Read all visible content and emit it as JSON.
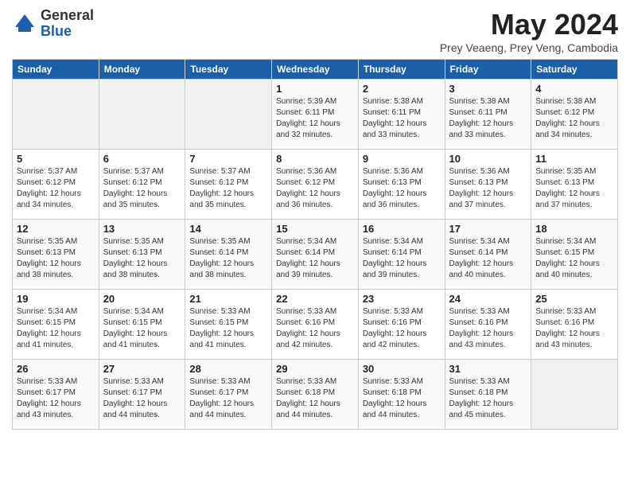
{
  "logo": {
    "general": "General",
    "blue": "Blue"
  },
  "title": "May 2024",
  "location": "Prey Veaeng, Prey Veng, Cambodia",
  "days_header": [
    "Sunday",
    "Monday",
    "Tuesday",
    "Wednesday",
    "Thursday",
    "Friday",
    "Saturday"
  ],
  "weeks": [
    [
      {
        "day": "",
        "info": ""
      },
      {
        "day": "",
        "info": ""
      },
      {
        "day": "",
        "info": ""
      },
      {
        "day": "1",
        "info": "Sunrise: 5:39 AM\nSunset: 6:11 PM\nDaylight: 12 hours\nand 32 minutes."
      },
      {
        "day": "2",
        "info": "Sunrise: 5:38 AM\nSunset: 6:11 PM\nDaylight: 12 hours\nand 33 minutes."
      },
      {
        "day": "3",
        "info": "Sunrise: 5:38 AM\nSunset: 6:11 PM\nDaylight: 12 hours\nand 33 minutes."
      },
      {
        "day": "4",
        "info": "Sunrise: 5:38 AM\nSunset: 6:12 PM\nDaylight: 12 hours\nand 34 minutes."
      }
    ],
    [
      {
        "day": "5",
        "info": "Sunrise: 5:37 AM\nSunset: 6:12 PM\nDaylight: 12 hours\nand 34 minutes."
      },
      {
        "day": "6",
        "info": "Sunrise: 5:37 AM\nSunset: 6:12 PM\nDaylight: 12 hours\nand 35 minutes."
      },
      {
        "day": "7",
        "info": "Sunrise: 5:37 AM\nSunset: 6:12 PM\nDaylight: 12 hours\nand 35 minutes."
      },
      {
        "day": "8",
        "info": "Sunrise: 5:36 AM\nSunset: 6:12 PM\nDaylight: 12 hours\nand 36 minutes."
      },
      {
        "day": "9",
        "info": "Sunrise: 5:36 AM\nSunset: 6:13 PM\nDaylight: 12 hours\nand 36 minutes."
      },
      {
        "day": "10",
        "info": "Sunrise: 5:36 AM\nSunset: 6:13 PM\nDaylight: 12 hours\nand 37 minutes."
      },
      {
        "day": "11",
        "info": "Sunrise: 5:35 AM\nSunset: 6:13 PM\nDaylight: 12 hours\nand 37 minutes."
      }
    ],
    [
      {
        "day": "12",
        "info": "Sunrise: 5:35 AM\nSunset: 6:13 PM\nDaylight: 12 hours\nand 38 minutes."
      },
      {
        "day": "13",
        "info": "Sunrise: 5:35 AM\nSunset: 6:13 PM\nDaylight: 12 hours\nand 38 minutes."
      },
      {
        "day": "14",
        "info": "Sunrise: 5:35 AM\nSunset: 6:14 PM\nDaylight: 12 hours\nand 38 minutes."
      },
      {
        "day": "15",
        "info": "Sunrise: 5:34 AM\nSunset: 6:14 PM\nDaylight: 12 hours\nand 39 minutes."
      },
      {
        "day": "16",
        "info": "Sunrise: 5:34 AM\nSunset: 6:14 PM\nDaylight: 12 hours\nand 39 minutes."
      },
      {
        "day": "17",
        "info": "Sunrise: 5:34 AM\nSunset: 6:14 PM\nDaylight: 12 hours\nand 40 minutes."
      },
      {
        "day": "18",
        "info": "Sunrise: 5:34 AM\nSunset: 6:15 PM\nDaylight: 12 hours\nand 40 minutes."
      }
    ],
    [
      {
        "day": "19",
        "info": "Sunrise: 5:34 AM\nSunset: 6:15 PM\nDaylight: 12 hours\nand 41 minutes."
      },
      {
        "day": "20",
        "info": "Sunrise: 5:34 AM\nSunset: 6:15 PM\nDaylight: 12 hours\nand 41 minutes."
      },
      {
        "day": "21",
        "info": "Sunrise: 5:33 AM\nSunset: 6:15 PM\nDaylight: 12 hours\nand 41 minutes."
      },
      {
        "day": "22",
        "info": "Sunrise: 5:33 AM\nSunset: 6:16 PM\nDaylight: 12 hours\nand 42 minutes."
      },
      {
        "day": "23",
        "info": "Sunrise: 5:33 AM\nSunset: 6:16 PM\nDaylight: 12 hours\nand 42 minutes."
      },
      {
        "day": "24",
        "info": "Sunrise: 5:33 AM\nSunset: 6:16 PM\nDaylight: 12 hours\nand 43 minutes."
      },
      {
        "day": "25",
        "info": "Sunrise: 5:33 AM\nSunset: 6:16 PM\nDaylight: 12 hours\nand 43 minutes."
      }
    ],
    [
      {
        "day": "26",
        "info": "Sunrise: 5:33 AM\nSunset: 6:17 PM\nDaylight: 12 hours\nand 43 minutes."
      },
      {
        "day": "27",
        "info": "Sunrise: 5:33 AM\nSunset: 6:17 PM\nDaylight: 12 hours\nand 44 minutes."
      },
      {
        "day": "28",
        "info": "Sunrise: 5:33 AM\nSunset: 6:17 PM\nDaylight: 12 hours\nand 44 minutes."
      },
      {
        "day": "29",
        "info": "Sunrise: 5:33 AM\nSunset: 6:18 PM\nDaylight: 12 hours\nand 44 minutes."
      },
      {
        "day": "30",
        "info": "Sunrise: 5:33 AM\nSunset: 6:18 PM\nDaylight: 12 hours\nand 44 minutes."
      },
      {
        "day": "31",
        "info": "Sunrise: 5:33 AM\nSunset: 6:18 PM\nDaylight: 12 hours\nand 45 minutes."
      },
      {
        "day": "",
        "info": ""
      }
    ]
  ]
}
